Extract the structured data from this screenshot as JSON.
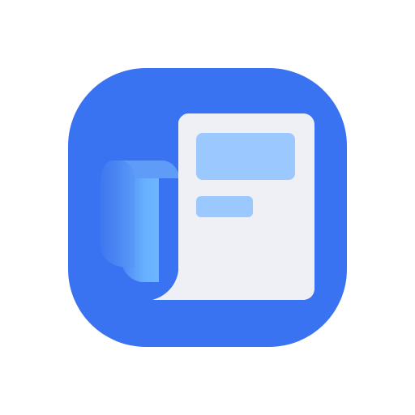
{
  "icon": {
    "name": "document-app-icon",
    "colors": {
      "background": "#3a73f2",
      "paper": "#eef0f5",
      "block_large": "#9bc8ff",
      "block_small": "#9bc8ff",
      "roll_light": "#66b0ff",
      "roll_dark": "#4f86f5"
    }
  }
}
